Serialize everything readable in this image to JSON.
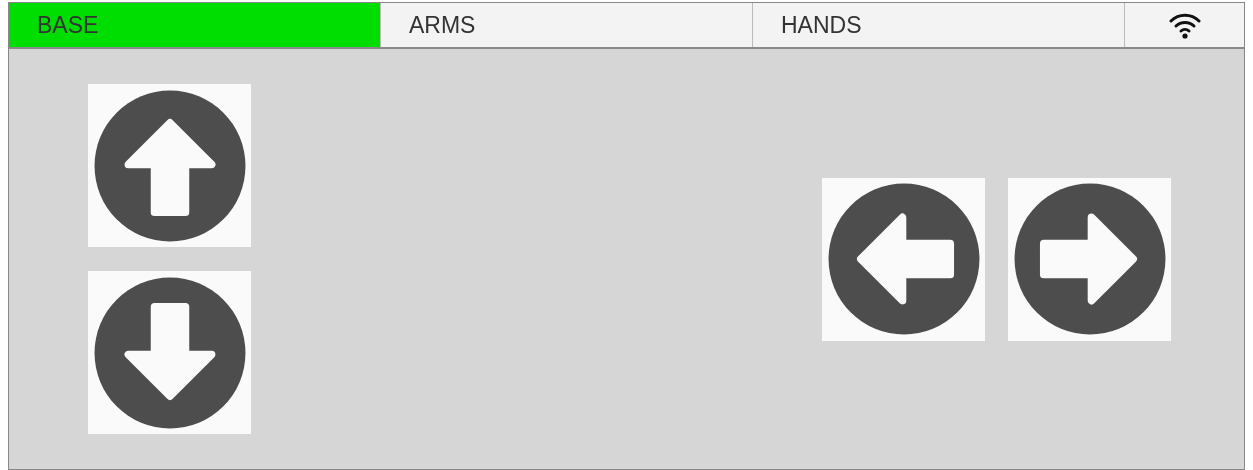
{
  "tabs": [
    {
      "label": "BASE",
      "selected": true
    },
    {
      "label": "ARMS",
      "selected": false
    },
    {
      "label": "HANDS",
      "selected": false
    }
  ],
  "left_controls": [
    {
      "kind": "up"
    },
    {
      "kind": "down"
    }
  ],
  "right_controls": [
    {
      "kind": "left"
    },
    {
      "kind": "right"
    }
  ]
}
